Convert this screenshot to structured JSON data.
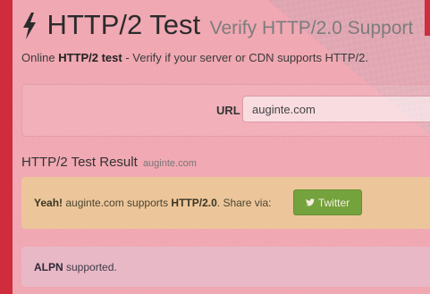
{
  "header": {
    "title": "HTTP/2 Test",
    "subtitle": "Verify HTTP/2.0 Support",
    "icon": "bolt-icon"
  },
  "tagline": {
    "prefix": "Online ",
    "bold": "HTTP/2 test",
    "suffix": " - Verify if your server or CDN supports HTTP/2."
  },
  "url_form": {
    "label": "URL",
    "value": "auginte.com"
  },
  "result": {
    "heading": "HTTP/2 Test Result",
    "domain": "auginte.com",
    "success": {
      "yeah": "Yeah!",
      "text_mid": " auginte.com supports ",
      "protocol": "HTTP/2.0",
      "share_text": ". Share via:"
    },
    "twitter_button": "Twitter",
    "alpn": {
      "bold": "ALPN",
      "text": " supported."
    }
  },
  "colors": {
    "overlay": "#f3a9b4",
    "success_bg": "#ecc69a",
    "twitter_green": "#74a23d",
    "info_bg": "#e8b8c6",
    "brand_red": "#cf2d3e"
  }
}
